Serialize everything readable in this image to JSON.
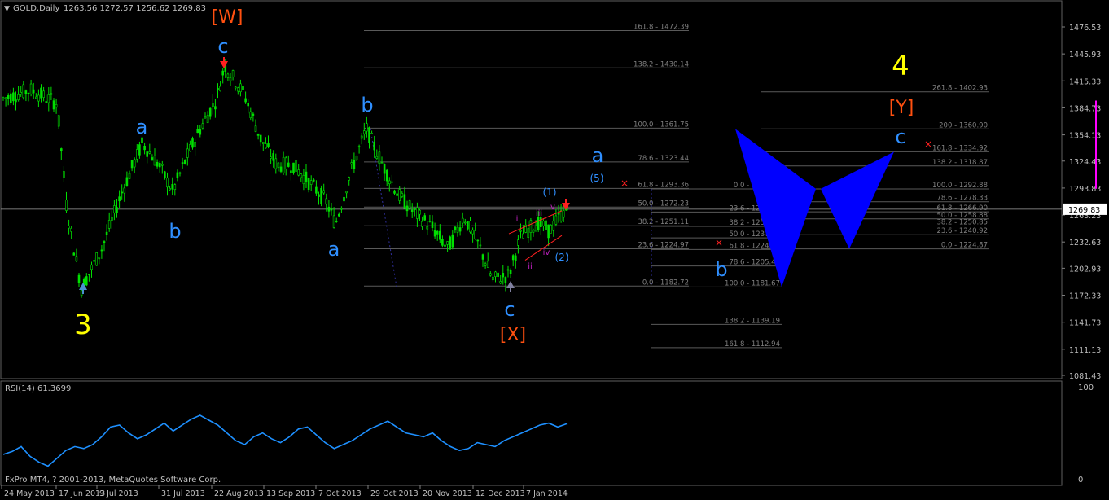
{
  "header": {
    "symbol_label": "GOLD,Daily",
    "ohlc_label": "1263.56 1272.57 1256.62 1269.83"
  },
  "price_axis": {
    "ticks": [
      "1476.53",
      "1445.93",
      "1415.33",
      "1384.73",
      "1354.13",
      "1324.43",
      "1293.83",
      "1263.23",
      "1232.63",
      "1202.93",
      "1172.33",
      "1141.73",
      "1111.13",
      "1081.43"
    ],
    "current_price": "1269.83"
  },
  "rsi": {
    "label": "RSI(14) 61.3699",
    "scale_top": "100",
    "scale_bottom": "0"
  },
  "date_axis": {
    "labels": [
      "24 May 2013",
      "17 Jun 2013",
      "9 Jul 2013",
      "31 Jul 2013",
      "22 Aug 2013",
      "13 Sep 2013",
      "7 Oct 2013",
      "29 Oct 2013",
      "20 Nov 2013",
      "12 Dec 2013",
      "7 Jan 2014"
    ]
  },
  "footer": {
    "copyright": "FxPro MT4, ? 2001-2013, MetaQuotes Software Corp."
  },
  "colors": {
    "background": "#000000",
    "candle_green": "#00e000",
    "wave_blue": "#2f8fff",
    "wave_yellow": "#ffff00",
    "wave_orange": "#ff5010",
    "fib_gray": "#808080",
    "pattern_blue": "#0000ff",
    "rsi_blue": "#1e90ff"
  },
  "wave_labels": [
    {
      "text": "[W]",
      "color": "orange"
    },
    {
      "text": "c",
      "color": "blue"
    },
    {
      "text": "a",
      "color": "blue"
    },
    {
      "text": "b",
      "color": "blue"
    },
    {
      "text": "3",
      "color": "yellow"
    },
    {
      "text": "b",
      "color": "blue"
    },
    {
      "text": "a",
      "color": "blue"
    },
    {
      "text": "c",
      "color": "blue"
    },
    {
      "text": "[X]",
      "color": "orange"
    },
    {
      "text": "a",
      "color": "blue"
    },
    {
      "text": "(5)",
      "color": "blue"
    },
    {
      "text": "(1)",
      "color": "blue"
    },
    {
      "text": "(2)",
      "color": "blue"
    },
    {
      "text": "i",
      "color": "magenta"
    },
    {
      "text": "ii",
      "color": "magenta"
    },
    {
      "text": "iii",
      "color": "magenta"
    },
    {
      "text": "iv",
      "color": "magenta"
    },
    {
      "text": "v",
      "color": "magenta"
    },
    {
      "text": "b",
      "color": "blue"
    },
    {
      "text": "4",
      "color": "yellow"
    },
    {
      "text": "[Y]",
      "color": "orange"
    },
    {
      "text": "c",
      "color": "blue"
    }
  ],
  "fib_levels": {
    "set1": [
      "161.8 - 1472.39",
      "138.2 - 1430.14",
      "100.0 - 1361.75",
      "78.6 - 1323.44",
      "61.8 - 1293.36",
      "50.0 - 1272.23",
      "38.2 - 1251.11",
      "23.6 - 1224.97",
      "0.0 - 1182.72"
    ],
    "set2": [
      "0.0 - 1292.88",
      "23.6 - 1266.64",
      "38.2 - 1250.40",
      "50.0 - 1237.28",
      "61.8 - 1224.16",
      "78.6 - 1205.47",
      "100.0 - 1181.67",
      "138.2 - 1139.19",
      "161.8 - 1112.94"
    ],
    "set3": [
      "261.8 - 1402.93",
      "200 - 1360.90",
      "161.8 - 1334.92",
      "138.2 - 1318.87",
      "100.0 - 1292.88",
      "78.6 - 1278.33",
      "61.8 - 1266.90",
      "50.0 - 1258.88",
      "38.2 - 1250.85",
      "23.6 - 1240.92",
      "0.0 - 1224.87"
    ]
  },
  "chart_data": {
    "type": "candlestick",
    "symbol": "GOLD",
    "timeframe": "Daily",
    "ylim": [
      1081.43,
      1493
    ],
    "key_points": [
      {
        "date": "24 May 2013",
        "price": 1395
      },
      {
        "date": "28 Jun 2013",
        "price": 1180
      },
      {
        "date": "17 Jul 2013",
        "price": 1345
      },
      {
        "date": "31 Jul 2013",
        "price": 1290
      },
      {
        "date": "28 Aug 2013",
        "price": 1433
      },
      {
        "date": "13 Sep 2013",
        "price": 1310
      },
      {
        "date": "15 Oct 2013",
        "price": 1253
      },
      {
        "date": "28 Oct 2013",
        "price": 1361
      },
      {
        "date": "3 Dec 2013",
        "price": 1210
      },
      {
        "date": "31 Dec 2013",
        "price": 1182
      },
      {
        "date": "27 Jan 2014",
        "price": 1280
      },
      {
        "date": "31 Jan 2014",
        "price": 1269.83
      }
    ],
    "rsi": {
      "period": 14,
      "last": 61.3699,
      "values": [
        30,
        33,
        38,
        28,
        22,
        18,
        26,
        34,
        38,
        36,
        40,
        48,
        58,
        60,
        52,
        46,
        50,
        56,
        62,
        54,
        60,
        66,
        70,
        65,
        60,
        52,
        44,
        40,
        48,
        52,
        46,
        42,
        48,
        56,
        58,
        50,
        42,
        36,
        40,
        44,
        50,
        56,
        60,
        64,
        58,
        52,
        50,
        48,
        52,
        44,
        38,
        34,
        36,
        42,
        40,
        38,
        44,
        48,
        52,
        56,
        60,
        62,
        58,
        61.37
      ]
    }
  }
}
